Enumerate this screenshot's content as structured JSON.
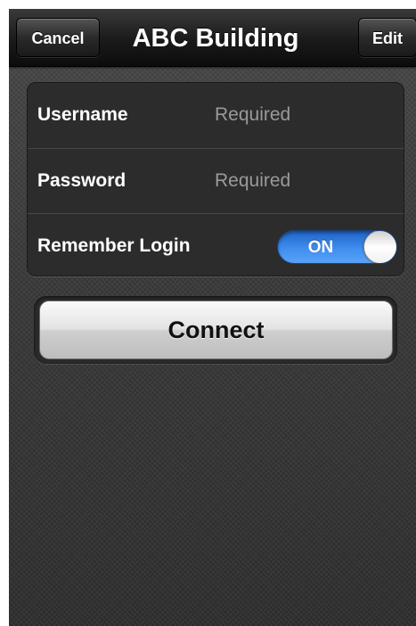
{
  "navbar": {
    "title": "ABC Building",
    "cancel_label": "Cancel",
    "edit_label": "Edit"
  },
  "form": {
    "username": {
      "label": "Username",
      "placeholder": "Required",
      "value": ""
    },
    "password": {
      "label": "Password",
      "placeholder": "Required",
      "value": ""
    },
    "remember_login": {
      "label": "Remember Login",
      "toggle_text": "ON",
      "on": true
    }
  },
  "connect_label": "Connect",
  "colors": {
    "toggle_on": "#3f8ef0",
    "background": "#3b3b3b",
    "navbar": "#1a1a1a"
  }
}
